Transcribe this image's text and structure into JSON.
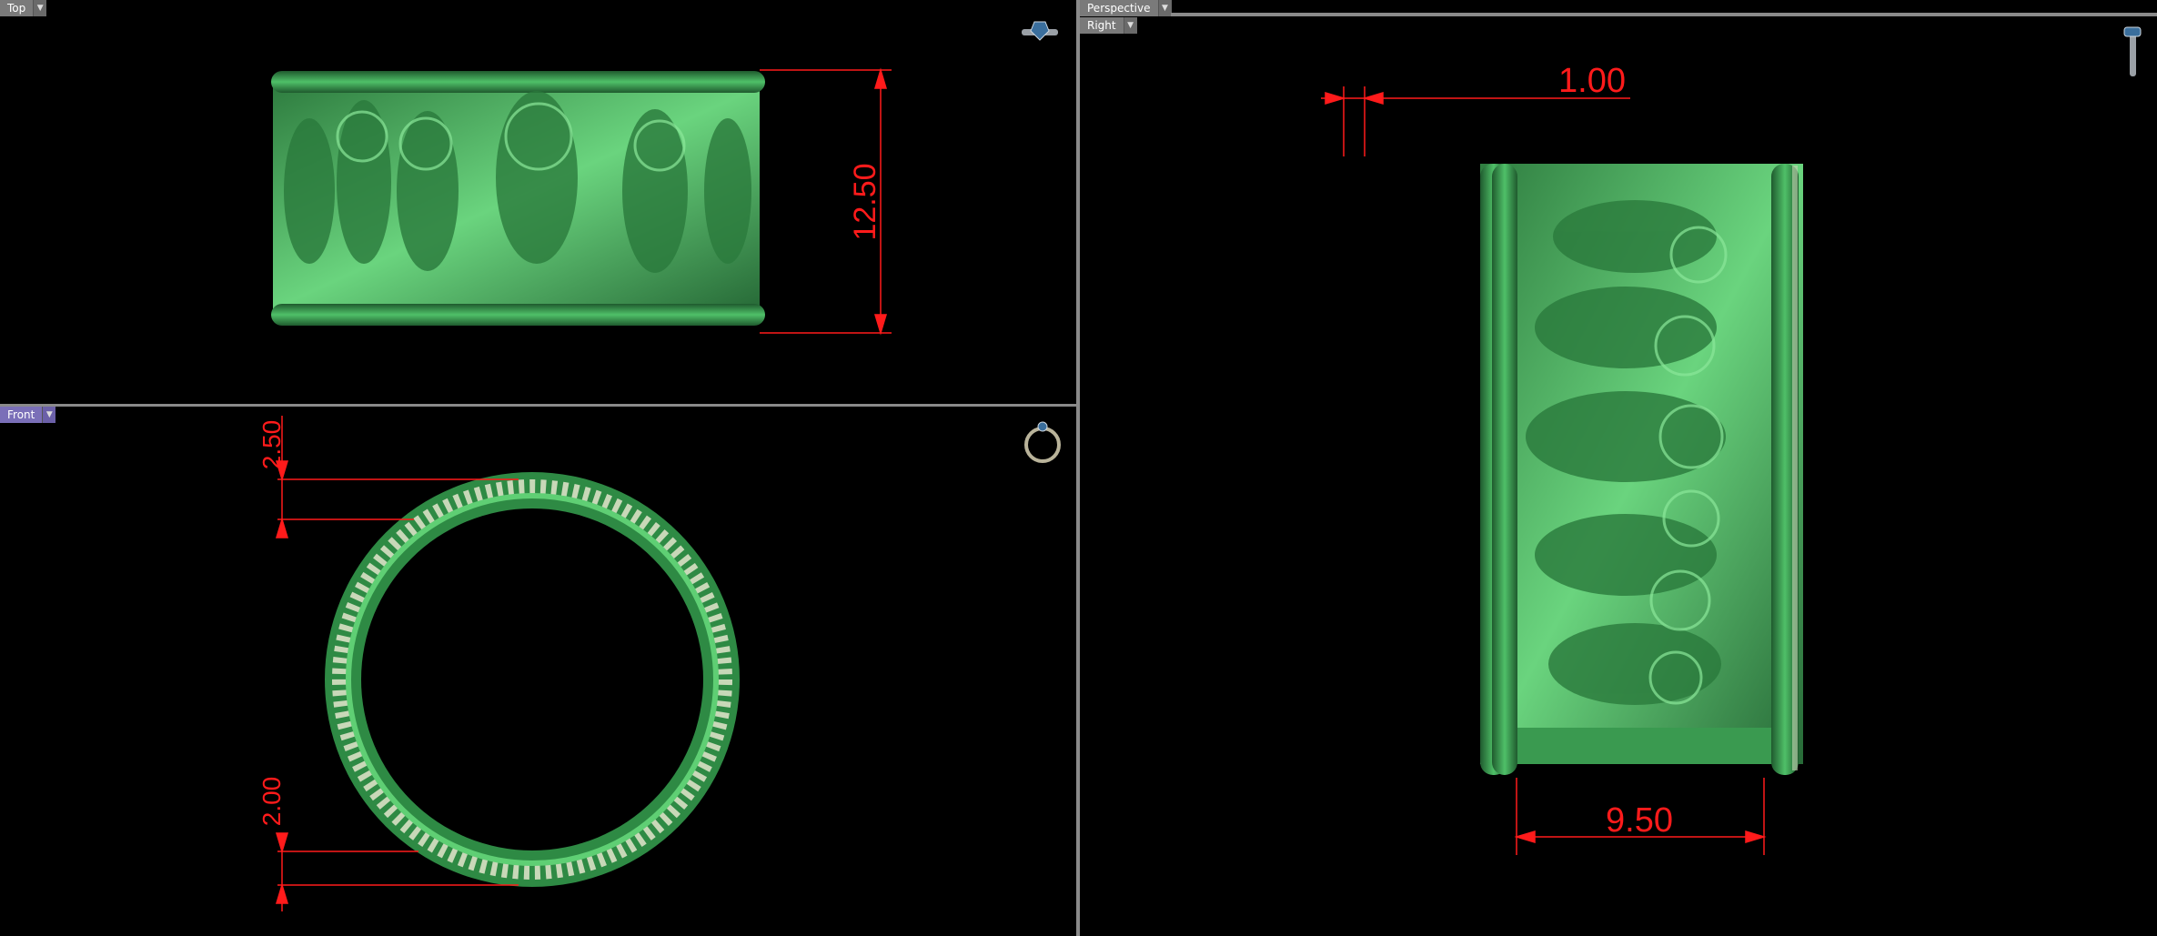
{
  "viewports": {
    "top": {
      "label": "Top"
    },
    "front": {
      "label": "Front"
    },
    "perspective": {
      "label": "Perspective"
    },
    "right": {
      "label": "Right"
    }
  },
  "dimensions": {
    "top_height": "12.50",
    "front_top": "2.50",
    "front_bottom": "2.00",
    "right_edge": "1.00",
    "right_width": "9.50"
  },
  "colors": {
    "dimension": "#ff1b1b",
    "model": "#3fae5a",
    "active_tab": "#7a6fb8"
  },
  "icons": {
    "top_corner": "ring-side-icon",
    "front_corner": "ring-front-icon",
    "right_corner": "ring-edge-icon"
  }
}
